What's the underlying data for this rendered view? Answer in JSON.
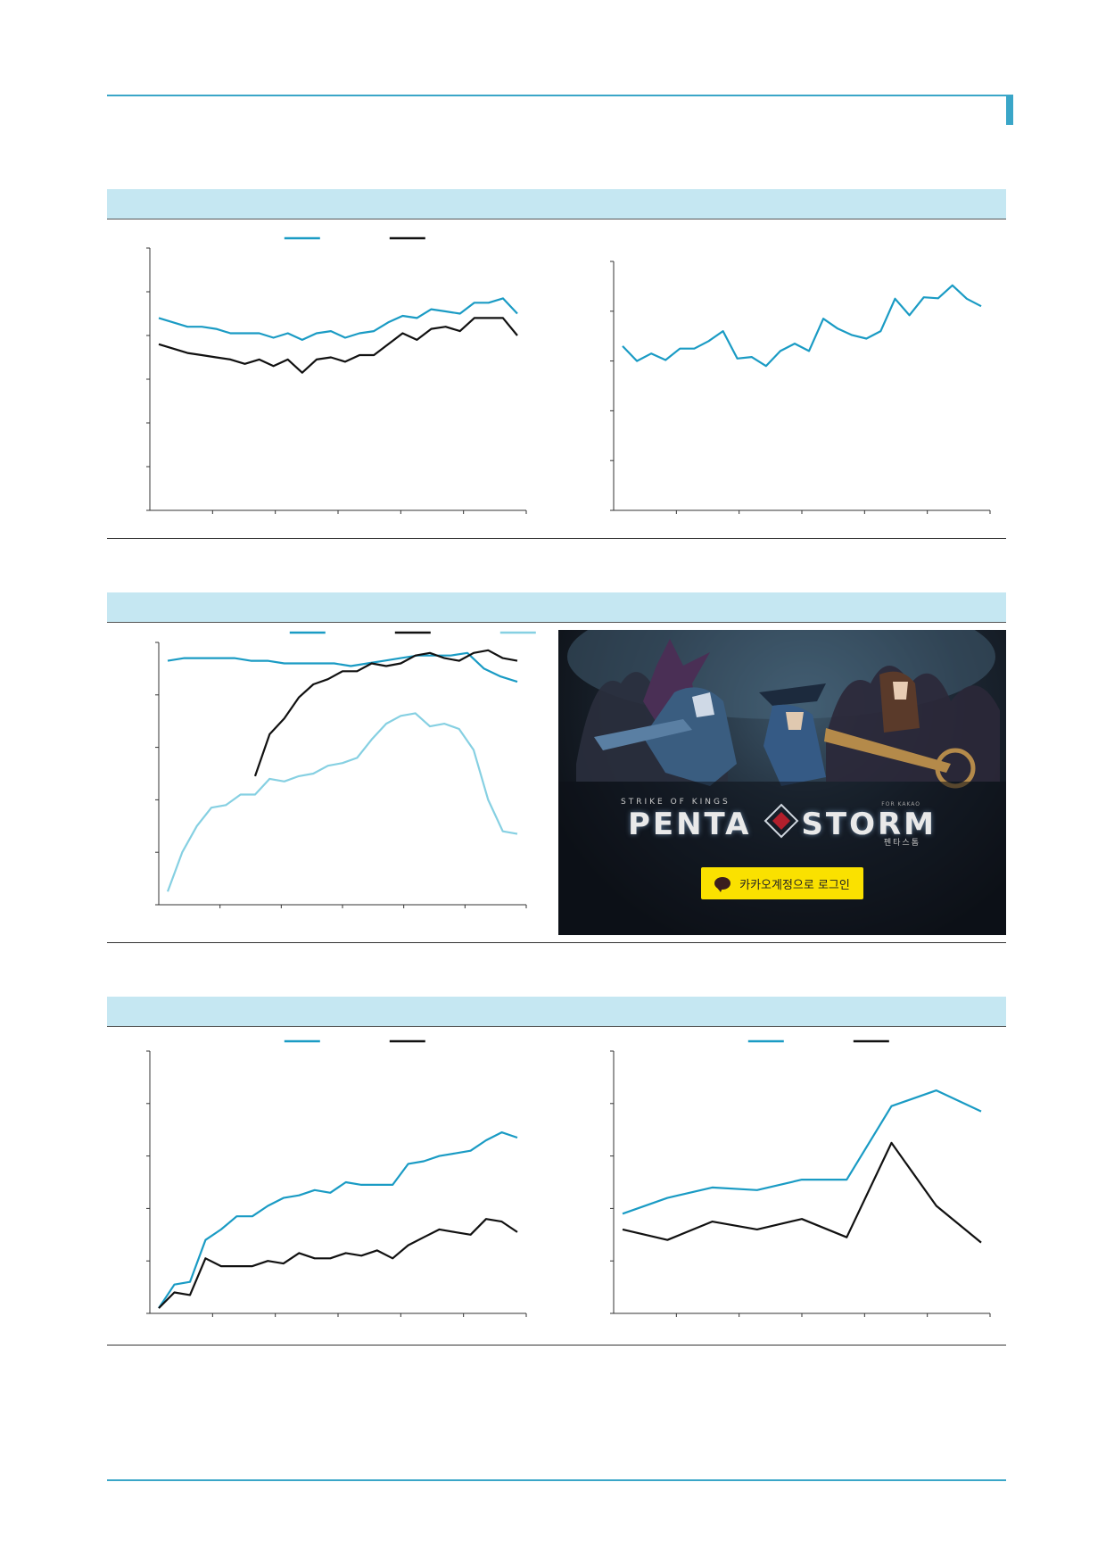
{
  "colors": {
    "accent": "#3aa6c8",
    "series_primary": "#1a9bc4",
    "series_secondary": "#111111",
    "series_light": "#86d0e2",
    "band": "#c5e7f2"
  },
  "advertisement": {
    "tagline": "STRIKE OF KINGS",
    "badge": "FOR KAKAO",
    "logo_left": "PENTA",
    "logo_right": "STORM",
    "subtitle_korean": "펜타스톰",
    "login_label": "카카오계정으로 로그인",
    "login_icon": "kakaotalk-speech-bubble-icon"
  },
  "chart_data": [
    {
      "id": "fig1-left",
      "type": "line",
      "ylim": [
        0,
        6
      ],
      "series": [
        {
          "values": [
            4.4,
            4.3,
            4.2,
            4.2,
            4.15,
            4.05,
            4.05,
            4.05,
            3.95,
            4.05,
            3.9,
            4.05,
            4.1,
            3.95,
            4.05,
            4.1,
            4.3,
            4.45,
            4.4,
            4.6,
            4.55,
            4.5,
            4.75,
            4.75,
            4.85,
            4.5
          ]
        },
        {
          "values": [
            3.8,
            3.7,
            3.6,
            3.55,
            3.5,
            3.45,
            3.35,
            3.45,
            3.3,
            3.45,
            3.15,
            3.45,
            3.5,
            3.4,
            3.55,
            3.55,
            3.8,
            4.05,
            3.9,
            4.15,
            4.2,
            4.1,
            4.4,
            4.4,
            4.4,
            4.0
          ]
        }
      ]
    },
    {
      "id": "fig1-right",
      "type": "line",
      "ylim": [
        0,
        5
      ],
      "series": [
        {
          "values": [
            3.3,
            3.0,
            3.15,
            3.02,
            3.25,
            3.25,
            3.4,
            3.6,
            3.05,
            3.08,
            2.9,
            3.2,
            3.35,
            3.2,
            3.85,
            3.65,
            3.52,
            3.45,
            3.6,
            4.25,
            3.92,
            4.28,
            4.26,
            4.52,
            4.25,
            4.1
          ]
        }
      ]
    },
    {
      "id": "fig2-left",
      "type": "line",
      "ylim": [
        0,
        5
      ],
      "series": [
        {
          "values": [
            4.65,
            4.7,
            4.7,
            4.7,
            4.7,
            4.65,
            4.65,
            4.6,
            4.6,
            4.6,
            4.6,
            4.55,
            4.6,
            4.65,
            4.7,
            4.75,
            4.75,
            4.75,
            4.8,
            4.5,
            4.35,
            4.25
          ]
        },
        {
          "values": [
            null,
            null,
            null,
            null,
            null,
            null,
            2.45,
            3.25,
            3.55,
            3.95,
            4.2,
            4.3,
            4.45,
            4.45,
            4.6,
            4.55,
            4.6,
            4.75,
            4.8,
            4.7,
            4.65,
            4.8,
            4.85,
            4.7,
            4.65
          ]
        },
        {
          "values": [
            0.25,
            1.0,
            1.5,
            1.85,
            1.9,
            2.1,
            2.1,
            2.4,
            2.35,
            2.45,
            2.5,
            2.65,
            2.7,
            2.8,
            3.15,
            3.45,
            3.6,
            3.65,
            3.4,
            3.45,
            3.35,
            2.95,
            2.0,
            1.4,
            1.35
          ]
        }
      ]
    },
    {
      "id": "fig3-left",
      "type": "line",
      "ylim": [
        0,
        5
      ],
      "series": [
        {
          "values": [
            0.1,
            0.55,
            0.6,
            1.4,
            1.6,
            1.85,
            1.85,
            2.05,
            2.2,
            2.25,
            2.35,
            2.3,
            2.5,
            2.45,
            2.45,
            2.45,
            2.85,
            2.9,
            3.0,
            3.05,
            3.1,
            3.3,
            3.45,
            3.35
          ]
        },
        {
          "values": [
            0.1,
            0.4,
            0.35,
            1.05,
            0.9,
            0.9,
            0.9,
            1.0,
            0.95,
            1.15,
            1.05,
            1.05,
            1.15,
            1.1,
            1.2,
            1.05,
            1.3,
            1.45,
            1.6,
            1.55,
            1.5,
            1.8,
            1.75,
            1.55
          ]
        }
      ]
    },
    {
      "id": "fig3-right",
      "type": "line",
      "ylim": [
        0,
        5
      ],
      "series": [
        {
          "values": [
            1.9,
            2.2,
            2.4,
            2.35,
            2.55,
            2.55,
            3.95,
            4.25,
            3.85
          ]
        },
        {
          "values": [
            1.6,
            1.4,
            1.75,
            1.6,
            1.8,
            1.45,
            3.25,
            2.05,
            1.35
          ]
        }
      ]
    }
  ]
}
